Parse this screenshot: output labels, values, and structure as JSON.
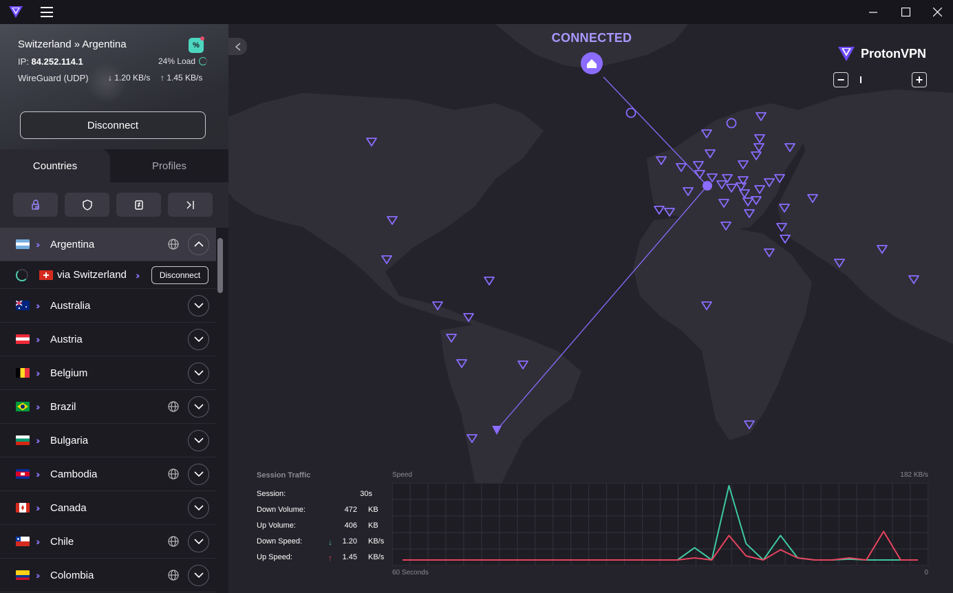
{
  "titlebar": {
    "icons": [
      "proton-vpn-logo-icon",
      "hamburger-menu-icon",
      "minimize-icon",
      "maximize-icon",
      "close-icon"
    ]
  },
  "connection": {
    "route": "Switzerland » Argentina",
    "ip_label": "IP:",
    "ip": "84.252.114.1",
    "load": "24% Load",
    "protocol": "WireGuard (UDP)",
    "down_speed": "1.20 KB/s",
    "up_speed": "1.45 KB/s",
    "disconnect_label": "Disconnect"
  },
  "tabs": [
    {
      "label": "Countries",
      "active": true
    },
    {
      "label": "Profiles",
      "active": false
    }
  ],
  "filters": [
    "secure-core-icon",
    "shield-icon",
    "p2p-icon",
    "tor-icon"
  ],
  "countries": [
    {
      "name": "Argentina",
      "flag": "ar",
      "globe": true,
      "expanded": true
    },
    {
      "name": "Australia",
      "flag": "au",
      "globe": false
    },
    {
      "name": "Austria",
      "flag": "at",
      "globe": false
    },
    {
      "name": "Belgium",
      "flag": "be",
      "globe": false
    },
    {
      "name": "Brazil",
      "flag": "br",
      "globe": true
    },
    {
      "name": "Bulgaria",
      "flag": "bg",
      "globe": false
    },
    {
      "name": "Cambodia",
      "flag": "kh",
      "globe": true
    },
    {
      "name": "Canada",
      "flag": "ca",
      "globe": false
    },
    {
      "name": "Chile",
      "flag": "cl",
      "globe": true
    },
    {
      "name": "Colombia",
      "flag": "co",
      "globe": true
    }
  ],
  "subserver": {
    "label": "via Switzerland",
    "disconnect_label": "Disconnect"
  },
  "map": {
    "status": "CONNECTED",
    "brand": "ProtonVPN",
    "zoom_minus": "−",
    "zoom_plus": "+"
  },
  "traffic": {
    "title": "Session Traffic",
    "stats": [
      {
        "key": "Session:",
        "value": "30s",
        "unit": ""
      },
      {
        "key": "Down Volume:",
        "value": "472",
        "unit": "KB"
      },
      {
        "key": "Up Volume:",
        "value": "406",
        "unit": "KB"
      },
      {
        "key": "Down Speed:",
        "value": "1.20",
        "unit": "KB/s",
        "arrow": "↓"
      },
      {
        "key": "Up Speed:",
        "value": "1.45",
        "unit": "KB/s",
        "arrow": "↑"
      }
    ],
    "graph": {
      "title": "Speed",
      "max_label": "182  KB/s",
      "x_left": "60 Seconds",
      "x_right": "0"
    },
    "colors": {
      "down": "#3ec9a0",
      "up": "#e8435f"
    }
  },
  "chart_data": {
    "type": "line",
    "title": "Speed",
    "xlabel": "",
    "ylabel": "",
    "x": [
      60,
      58,
      56,
      54,
      52,
      50,
      48,
      46,
      44,
      42,
      40,
      38,
      36,
      34,
      32,
      30,
      28,
      26,
      24,
      22,
      20,
      18,
      16,
      14,
      12,
      10,
      8,
      6,
      4,
      2,
      0
    ],
    "ylim": [
      0,
      182
    ],
    "series": [
      {
        "name": "Down Speed",
        "values": [
          0,
          0,
          0,
          0,
          0,
          0,
          0,
          0,
          0,
          0,
          0,
          0,
          0,
          0,
          0,
          0,
          0,
          30,
          0,
          182,
          40,
          0,
          60,
          5,
          0,
          0,
          2,
          0,
          0,
          0,
          0
        ]
      },
      {
        "name": "Up Speed",
        "values": [
          0,
          0,
          0,
          0,
          0,
          0,
          0,
          0,
          0,
          0,
          0,
          0,
          0,
          0,
          0,
          0,
          0,
          5,
          0,
          60,
          10,
          0,
          25,
          5,
          0,
          0,
          5,
          0,
          70,
          0,
          0
        ]
      }
    ]
  }
}
